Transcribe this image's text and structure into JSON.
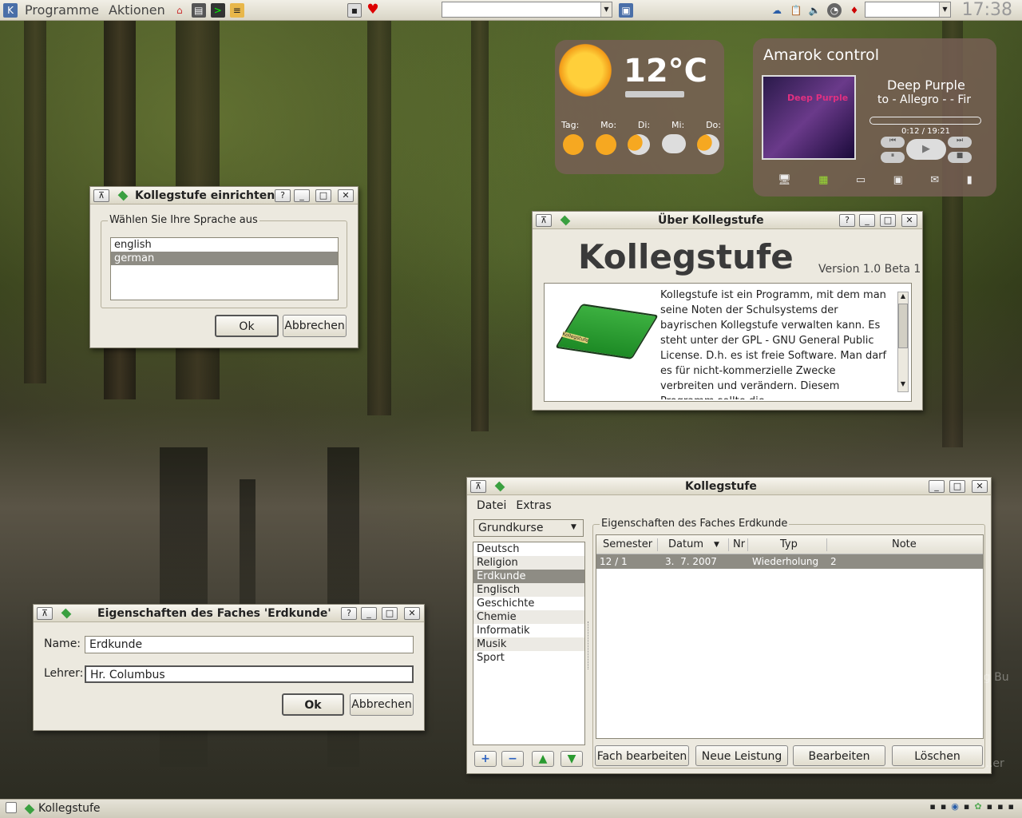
{
  "panel": {
    "menu1": "Programme",
    "menu2": "Aktionen",
    "clock": "17:38"
  },
  "weather": {
    "temp": "12°C",
    "days": [
      "Tag:",
      "Mo:",
      "Di:",
      "Mi:",
      "Do:"
    ]
  },
  "amarok": {
    "title": "Amarok control",
    "artist": "Deep Purple",
    "track": "to - Allegro -  - Fir",
    "time": "0:12 / 19:21",
    "album_text": "Deep Purple"
  },
  "dlg_setup": {
    "title": "Kollegstufe einrichten",
    "group": "Wählen Sie Ihre Sprache aus",
    "languages": [
      "english",
      "german"
    ],
    "ok": "Ok",
    "cancel": "Abbrechen"
  },
  "dlg_about": {
    "title": "Über Kollegstufe",
    "heading": "Kollegstufe",
    "version": "Version 1.0 Beta 1",
    "text": "Kollegstufe ist ein Programm, mit dem man seine Noten der Schulsystems der bayrischen Kollegstufe verwalten kann. Es steht unter der GPL - GNU General Public License. D.h. es ist freie Software. Man darf es für nicht-kommerzielle Zwecke verbreiten und verändern. Diesem Programm sollte die",
    "binder_label": "Kollegstufe"
  },
  "dlg_props": {
    "title": "Eigenschaften des Faches 'Erdkunde'",
    "name_label": "Name:",
    "name_value": "Erdkunde",
    "teacher_label": "Lehrer:",
    "teacher_value": "Hr. Columbus",
    "ok": "Ok",
    "cancel": "Abbrechen"
  },
  "main": {
    "title": "Kollegstufe",
    "menu": [
      "Datei",
      "Extras"
    ],
    "combo": "Grundkurse",
    "subjects": [
      "Deutsch",
      "Religion",
      "Erdkunde",
      "Englisch",
      "Geschichte",
      "Chemie",
      "Informatik",
      "Musik",
      "Sport"
    ],
    "selected_subject": 2,
    "group": "Eigenschaften des Faches Erdkunde",
    "columns": [
      "Semester",
      "Datum",
      "Nr",
      "Typ",
      "Note"
    ],
    "rows": [
      {
        "semester": "12 / 1",
        "datum": "3.  7. 2007",
        "nr": "",
        "typ": "Wiederholung",
        "note": "2"
      }
    ],
    "buttons": [
      "Fach bearbeiten",
      "Neue Leistung",
      "Bearbeiten",
      "Löschen"
    ]
  },
  "taskbar": {
    "task": "Kollegstufe"
  },
  "desktop_text": {
    "a": "...playing Bu",
    "b": "...er"
  }
}
